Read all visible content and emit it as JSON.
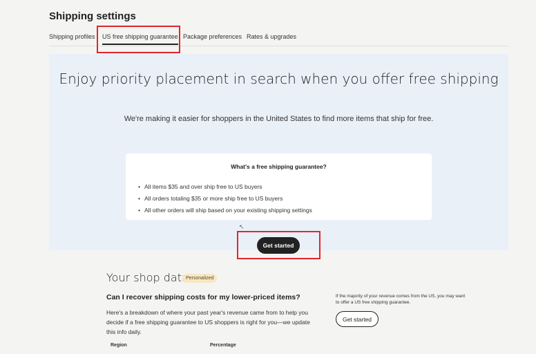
{
  "page": {
    "title": "Shipping settings"
  },
  "tabs": [
    {
      "label": "Shipping profiles",
      "active": false
    },
    {
      "label": "US free shipping guarantee",
      "active": true
    },
    {
      "label": "Package preferences",
      "active": false
    },
    {
      "label": "Rates & upgrades",
      "active": false
    }
  ],
  "hero": {
    "title": "Enjoy priority placement in search when you offer free shipping",
    "subtitle": "We're making it easier for shoppers in the United States to find more items that ship for free.",
    "card": {
      "title": "What's a free shipping guarantee?",
      "items": [
        "All items $35 and over ship free to US buyers",
        "All orders totaling $35 or more ship free to US buyers",
        "All other orders will ship based on your existing shipping settings"
      ]
    },
    "cta_label": "Get started"
  },
  "shop_data": {
    "title": "Your shop data",
    "badge": "Personalized",
    "question": "Can I recover shipping costs for my lower-priced items?",
    "body": "Here's a breakdown of where your past year's revenue came from to help you decide if a free shipping guarantee to US shoppers is right for you—we update this info daily.",
    "table_headers": [
      "Region",
      "Percentage"
    ],
    "side_note": "If the majority of your revenue comes from the US, you may want to offer a US free shipping guarantee.",
    "cta_label": "Get started"
  },
  "colors": {
    "accent": "#222222",
    "hero_background": "#eaf0f8",
    "highlight_annotation": "#e0262b",
    "badge_background": "#f7e7c4"
  }
}
